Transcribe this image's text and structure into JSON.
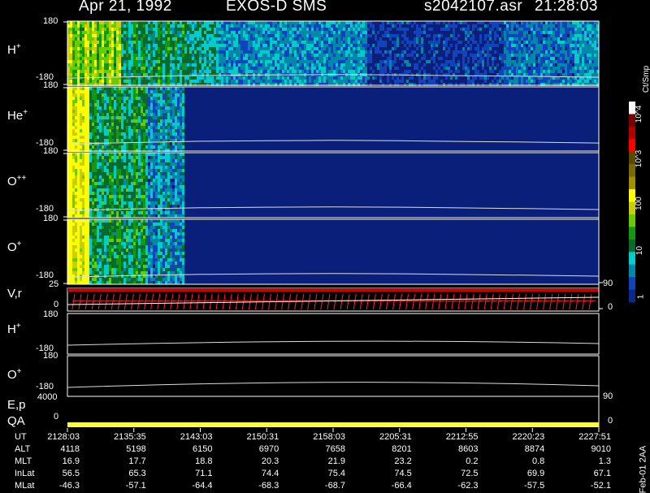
{
  "header": {
    "date": "Apr 21, 1992",
    "instrument": "EXOS-D SMS",
    "file": "s2042107.asr",
    "time": "21:28:03"
  },
  "panels": [
    {
      "label": "H",
      "sup": "+",
      "ymax": "180",
      "ymin": "-180"
    },
    {
      "label": "He",
      "sup": "+",
      "ymax": "180",
      "ymin": "-180"
    },
    {
      "label": "O",
      "sup": "++",
      "ymax": "180",
      "ymin": "-180"
    },
    {
      "label": "O",
      "sup": "+",
      "ymax": "180",
      "ymin": "-180"
    }
  ],
  "line_panels": {
    "vr": {
      "label": "V,r",
      "ymax": "25",
      "ymin": "0",
      "right_top": "90",
      "right_bottom": "0"
    },
    "h": {
      "label": "H",
      "sup": "+",
      "ymax": "180",
      "ymin": "-180"
    },
    "o": {
      "label": "O",
      "sup": "+",
      "ymax": "180",
      "ymin": "-180"
    },
    "ep": {
      "label": "E,p",
      "ytick": "4000",
      "right": "90"
    },
    "qa": {
      "label": "QA",
      "ytick": "0",
      "right": "0"
    }
  },
  "colorbar": {
    "title": "Ct/Smp",
    "ticks": [
      "10^4",
      "10^3",
      "100",
      "10",
      "1"
    ],
    "colors": [
      "#ffffff",
      "#7a0000",
      "#b00000",
      "#ff0000",
      "#5a4a00",
      "#7a6a00",
      "#a09000",
      "#ffff00",
      "#c8d000",
      "#66cc00",
      "#119911",
      "#0a6a2a",
      "#00cccc",
      "#0088aa",
      "#1144bb",
      "#0a2a8a"
    ]
  },
  "chart_data": {
    "type": "heatmap",
    "time_axis": [
      "2128:03",
      "2135:35",
      "2143:03",
      "2150:31",
      "2158:03",
      "2205:31",
      "2212:55",
      "2220:23",
      "2227:51"
    ],
    "ephemeris": [
      {
        "name": "UT",
        "values": [
          "2128:03",
          "2135:35",
          "2143:03",
          "2150:31",
          "2158:03",
          "2205:31",
          "2212:55",
          "2220:23",
          "2227:51"
        ]
      },
      {
        "name": "ALT",
        "values": [
          "4118",
          "5198",
          "6150",
          "6970",
          "7658",
          "8201",
          "8603",
          "8874",
          "9010"
        ]
      },
      {
        "name": "MLT",
        "values": [
          "16.9",
          "17.7",
          "18.8",
          "20.3",
          "21.9",
          "23.2",
          "0.2",
          "0.8",
          "1.3"
        ]
      },
      {
        "name": "InLat",
        "values": [
          "56.5",
          "65.3",
          "71.1",
          "74.4",
          "75.4",
          "74.5",
          "72.5",
          "69.9",
          "67.1"
        ]
      },
      {
        "name": "MLat",
        "values": [
          "-46.3",
          "-57.1",
          "-64.4",
          "-68.3",
          "-68.7",
          "-66.4",
          "-62.3",
          "-57.5",
          "-52.1"
        ]
      }
    ],
    "panels": [
      {
        "name": "H+",
        "ylim": [
          -180,
          180
        ],
        "zlabel": "Ct/Smp",
        "zscale": "log",
        "zlim": [
          1,
          10000
        ],
        "trace_y": [
          -140,
          -132,
          -125,
          -122,
          -120,
          -122,
          -126,
          -130,
          -135
        ]
      },
      {
        "name": "He+",
        "ylim": [
          -180,
          180
        ],
        "zscale": "log",
        "trace_y": [
          -140,
          -132,
          -125,
          -122,
          -120,
          -122,
          -126,
          -130,
          -135
        ]
      },
      {
        "name": "O++",
        "ylim": [
          -180,
          180
        ],
        "zscale": "log",
        "trace_y": [
          -140,
          -132,
          -125,
          -122,
          -120,
          -122,
          -126,
          -130,
          -135
        ]
      },
      {
        "name": "O+",
        "ylim": [
          -180,
          180
        ],
        "zscale": "log",
        "trace_y": [
          -140,
          -132,
          -125,
          -122,
          -120,
          -122,
          -126,
          -130,
          -135
        ]
      }
    ],
    "footer_note": "Feb-01 2AA"
  }
}
